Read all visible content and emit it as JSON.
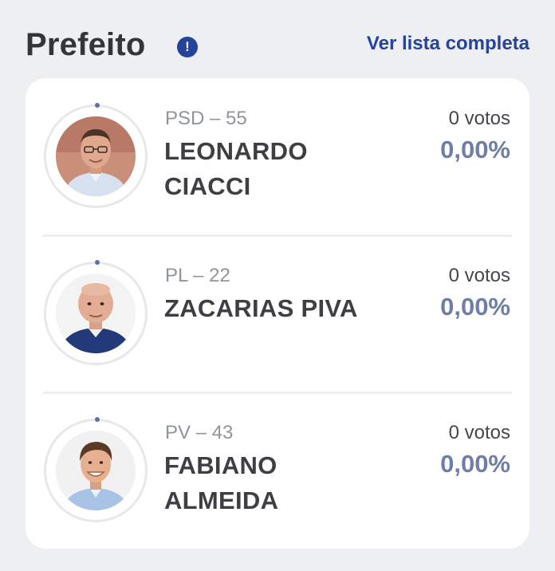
{
  "header": {
    "title": "Prefeito",
    "info_icon": "!",
    "see_all_label": "Ver lista completa"
  },
  "colors": {
    "accent": "#24439b",
    "percent": "#6e7ea9",
    "background": "#eeeff2",
    "card": "#ffffff"
  },
  "candidates": [
    {
      "party": "PSD – 55",
      "name_line1": "LEONARDO",
      "name_line2": "CIACCI",
      "votes": "0 votos",
      "percent": "0,00%",
      "avatar_icon": "candidate-photo"
    },
    {
      "party": "PL – 22",
      "name_line1": "ZACARIAS PIVA",
      "name_line2": "",
      "votes": "0 votos",
      "percent": "0,00%",
      "avatar_icon": "candidate-photo"
    },
    {
      "party": "PV – 43",
      "name_line1": "FABIANO",
      "name_line2": "ALMEIDA",
      "votes": "0 votos",
      "percent": "0,00%",
      "avatar_icon": "candidate-photo"
    }
  ]
}
